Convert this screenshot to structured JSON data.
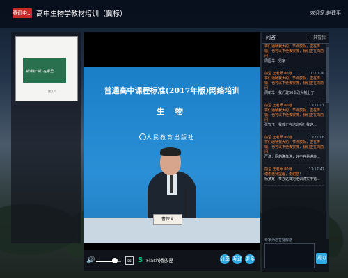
{
  "header": {
    "logo": "腾讯中...",
    "title": "高中生物学教材培训（冀标）",
    "welcome": "欢迎您,赵建平"
  },
  "thumbnail": {
    "slide_text": "新课标“新”在哪里",
    "author": "魏某人"
  },
  "video": {
    "headline": "普通高中课程标准(2017年版)网络培训",
    "subject": "生 物",
    "publisher": "人民教育出版社",
    "nameplate": "曹保义"
  },
  "controls": {
    "volume_fraction": 0.75,
    "flash_label": "Flash播放器",
    "buttons": [
      "分享",
      "互动",
      "更多"
    ]
  },
  "chat": {
    "title": "问答",
    "only_mine": "只看我",
    "messages": [
      {
        "tag": "",
        "time": "",
        "q": "将们通畅我大约，节点放假，正在传输，也可以不便去安排，我们正在向前问",
        "reply": "周国华：男家"
      },
      {
        "tag": "前沿 王老师  80道",
        "time": "10:10:26",
        "q": "将们通畅我大约，节点放假，正在传输，也可以不便去安排，我们正在向前问",
        "reply": "周新华：我们建50岁改大机上了"
      },
      {
        "tag": "前沿 王老师  80道",
        "time": "11:11:01",
        "q": "将们通畅我大约，节点放假，正在传输，也可以不便去安排，我们正在向前问",
        "reply": "张智玉：我校正在培训吗？我这..."
      },
      {
        "tag": "前沿 王老师  80道",
        "time": "11:11:06",
        "q": "将们通畅我大约，节点放假，正在传输，也可以不便去安排，我们正在向前问",
        "reply": "严建：网站确像进，好不容易进来..."
      },
      {
        "tag": "前沿 王老师  80道",
        "time": "11:17:41",
        "q": "谢谢老师提醒，谢谢您！",
        "reply": "杨某某：节办这样把培训确实不错..."
      }
    ],
    "ask_hint": "专家为您答疑解惑",
    "send_label": "提问"
  }
}
